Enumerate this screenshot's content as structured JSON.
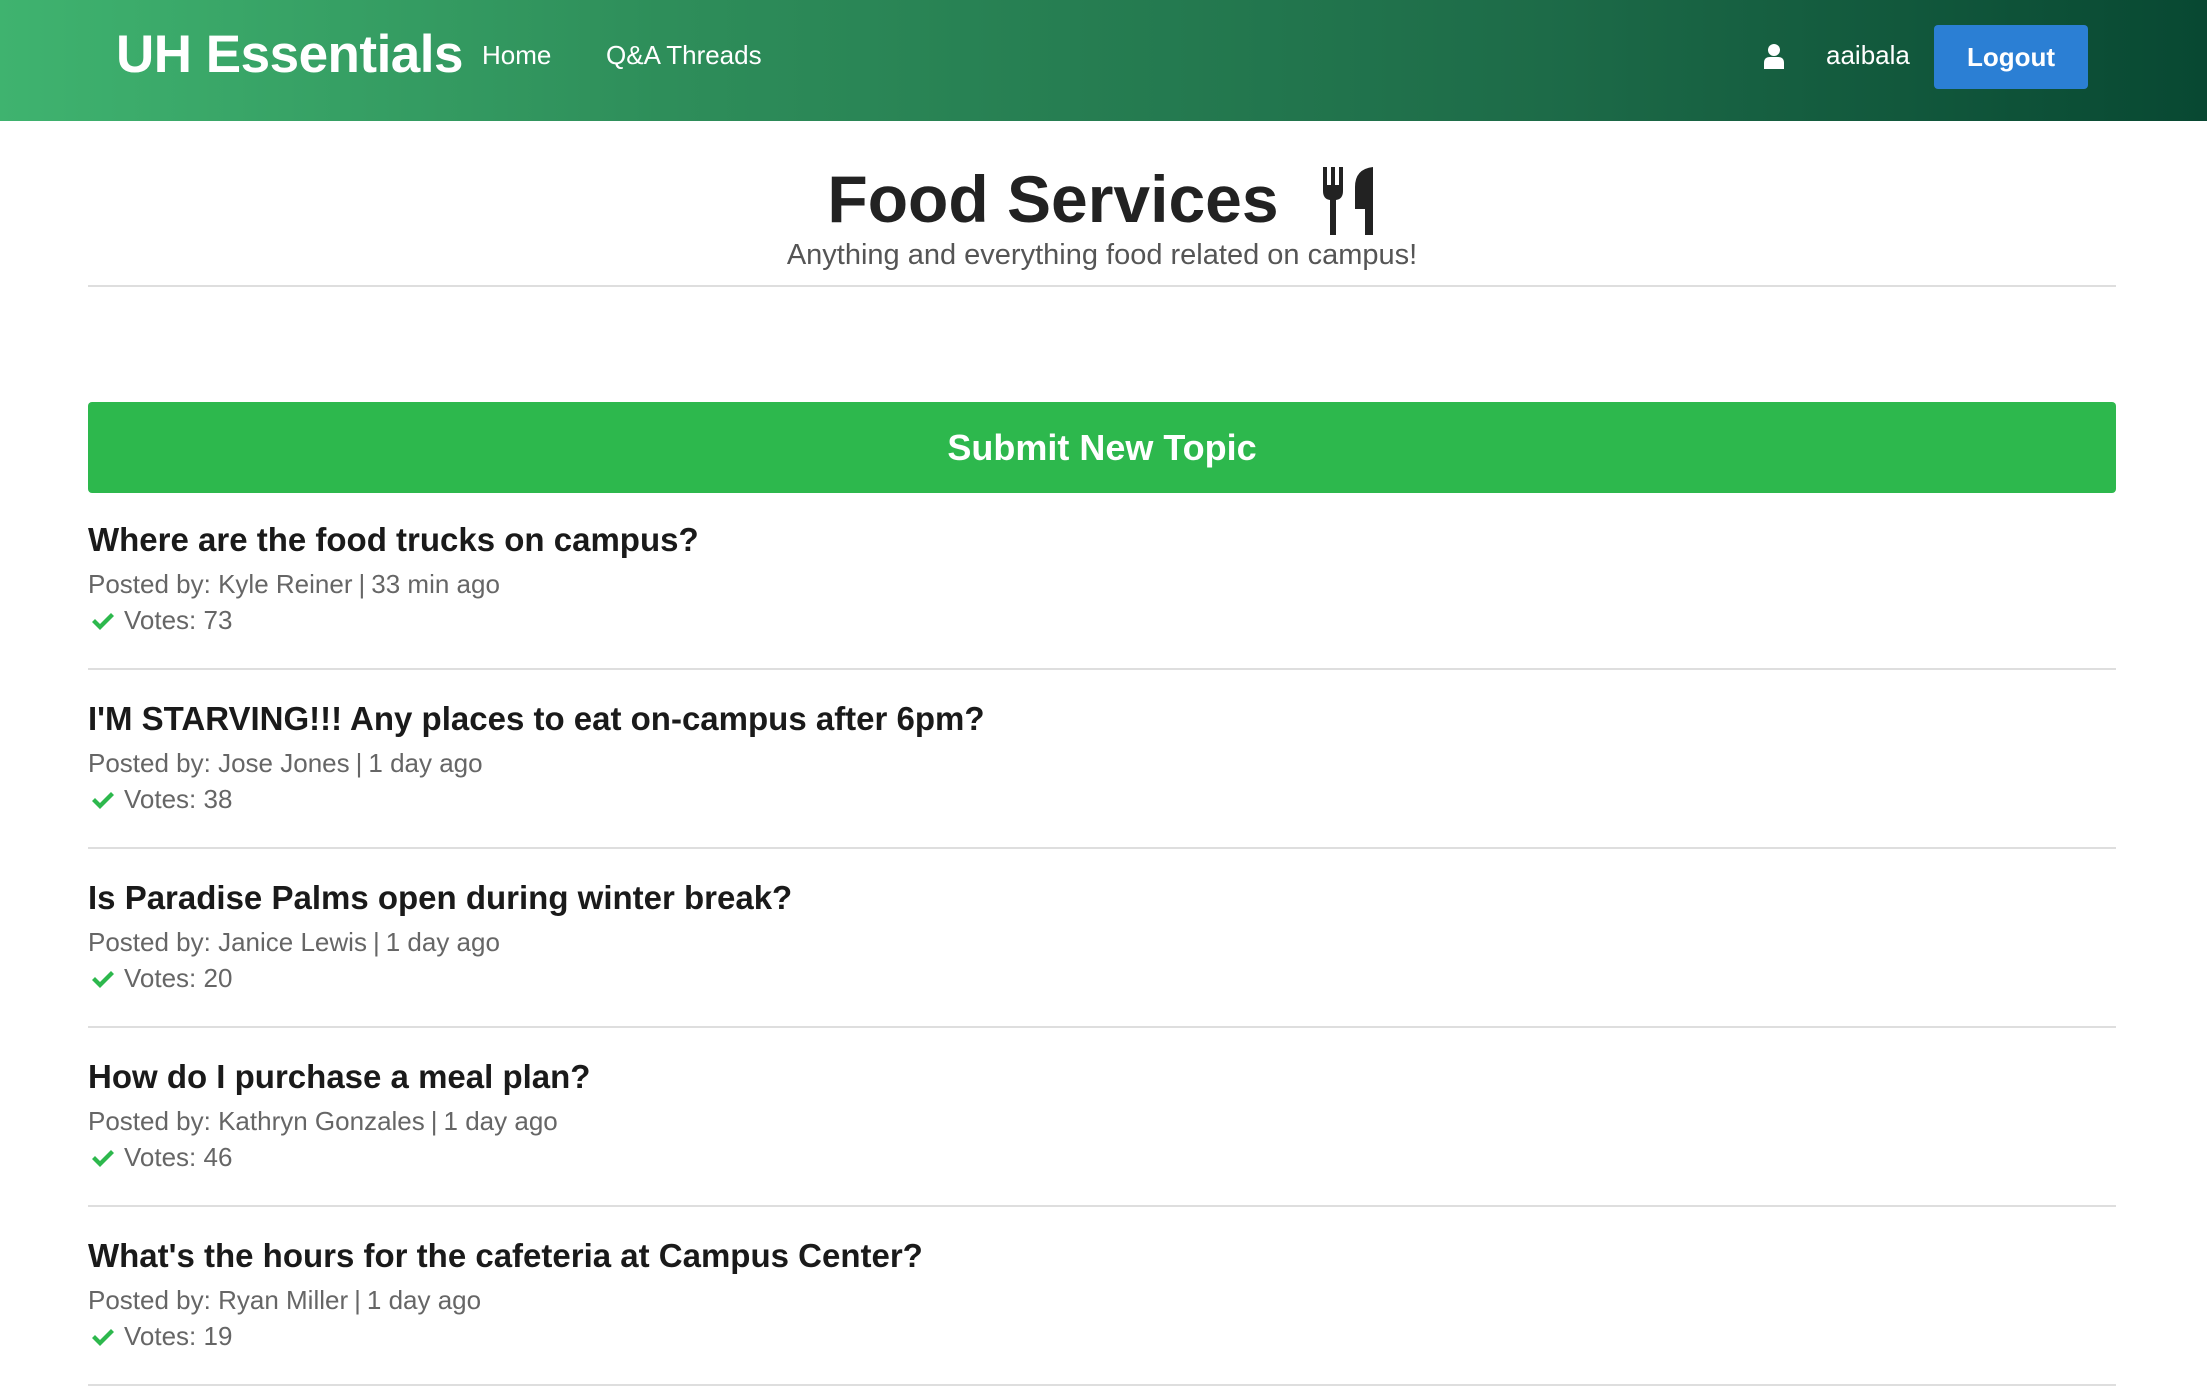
{
  "navbar": {
    "brand": "UH Essentials",
    "links": [
      {
        "label": "Home"
      },
      {
        "label": "Q&A Threads"
      }
    ],
    "user_icon": "user-icon",
    "username": "aaibala",
    "logout_label": "Logout",
    "gradient_colors": [
      "#3fb36f",
      "#084832"
    ],
    "logout_color": "#2b7fd4"
  },
  "header": {
    "title": "Food Services",
    "title_icon": "utensils-icon",
    "subtitle": "Anything and everything food related on campus!"
  },
  "submit": {
    "label": "Submit New Topic",
    "color": "#2db84d"
  },
  "topics": [
    {
      "title": "Where are the food trucks on campus?",
      "posted_by_label": "Posted by:",
      "author": "Kyle Reiner",
      "time": "33 min ago",
      "votes_label": "Votes:",
      "votes": "73"
    },
    {
      "title": "I'M STARVING!!! Any places to eat on-campus after 6pm?",
      "posted_by_label": "Posted by:",
      "author": "Jose Jones",
      "time": "1 day ago",
      "votes_label": "Votes:",
      "votes": "38"
    },
    {
      "title": "Is Paradise Palms open during winter break?",
      "posted_by_label": "Posted by:",
      "author": "Janice Lewis",
      "time": "1 day ago",
      "votes_label": "Votes:",
      "votes": "20"
    },
    {
      "title": "How do I purchase a meal plan?",
      "posted_by_label": "Posted by:",
      "author": "Kathryn Gonzales",
      "time": "1 day ago",
      "votes_label": "Votes:",
      "votes": "46"
    },
    {
      "title": "What's the hours for the cafeteria at Campus Center?",
      "posted_by_label": "Posted by:",
      "author": "Ryan Miller",
      "time": "1 day ago",
      "votes_label": "Votes:",
      "votes": "19"
    }
  ],
  "vote_icon": "check-icon",
  "vote_icon_color": "#2db84d"
}
